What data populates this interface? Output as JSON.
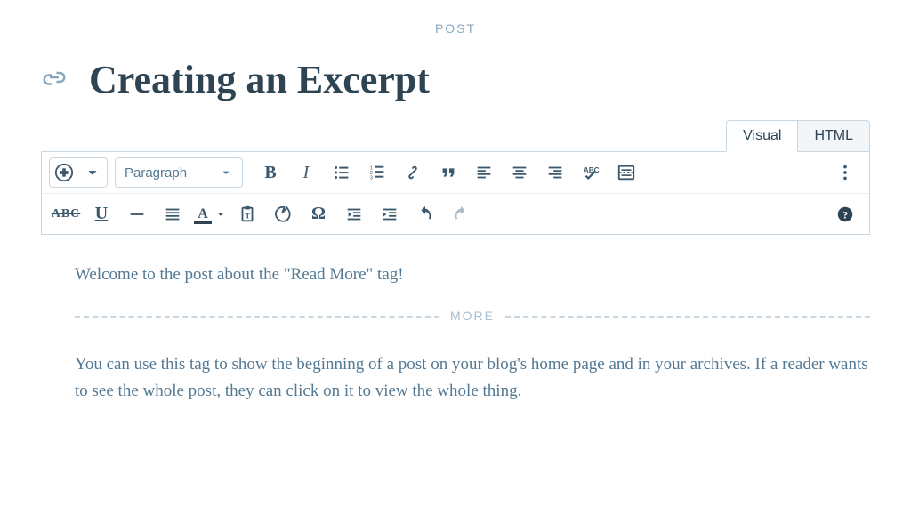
{
  "post_type_label": "POST",
  "title": "Creating an Excerpt",
  "tabs": {
    "visual": "Visual",
    "html": "HTML"
  },
  "format_select": "Paragraph",
  "content": {
    "p1": "Welcome to the post about the \"Read More\" tag!",
    "more_label": "MORE",
    "p2": "You can use this tag to show the beginning of a post on your blog's home page and in your archives. If a reader wants to see the whole post, they can click on it to view the whole thing."
  },
  "glyphs": {
    "bold": "B",
    "italic": "I",
    "strike": "ABC",
    "underline": "U",
    "textcolor": "A",
    "omega": "Ω"
  }
}
